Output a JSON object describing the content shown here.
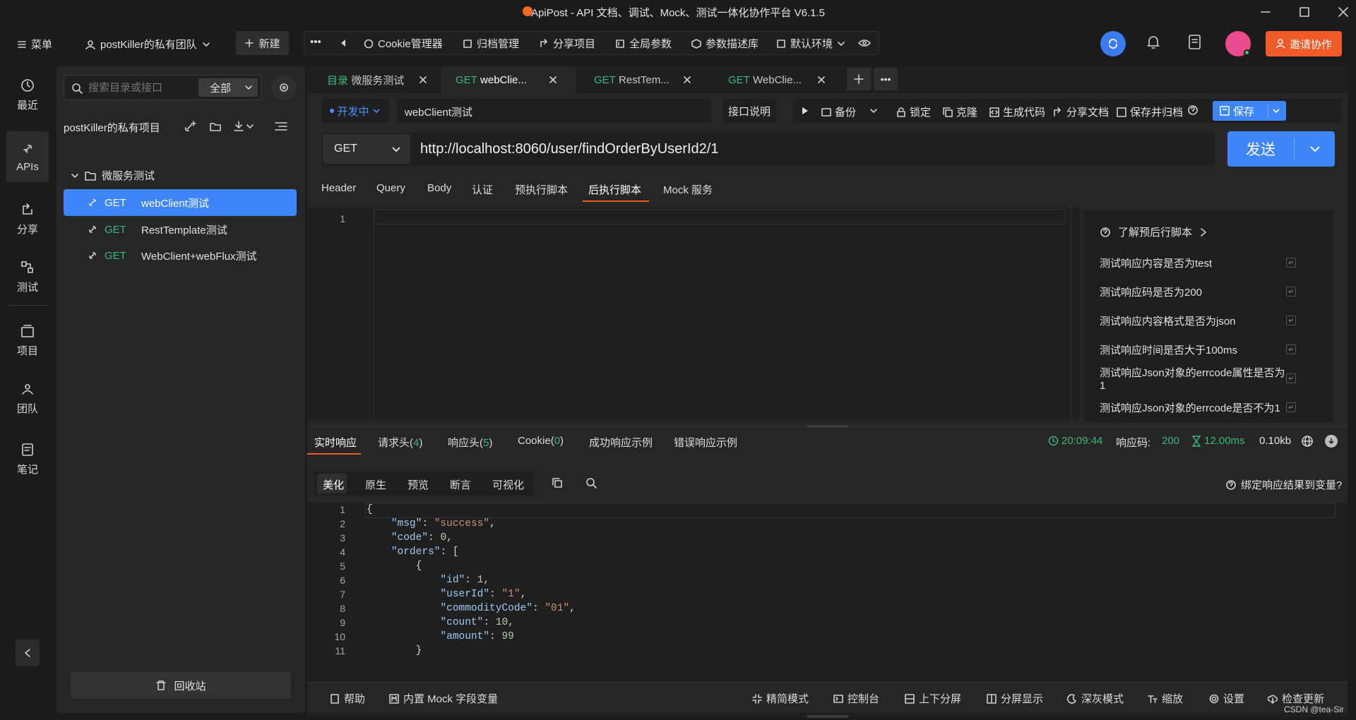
{
  "window": {
    "title": "ApiPost - API 文档、调试、Mock、测试一体化协作平台 V6.1.5"
  },
  "topbar": {
    "menu": "菜单",
    "team": "postKiller的私有团队",
    "new": "新建",
    "cookie": "Cookie管理器",
    "archive": "归档管理",
    "share": "分享项目",
    "global": "全局参数",
    "params": "参数描述库",
    "env": "默认环境",
    "invite": "邀请协作"
  },
  "nav": [
    {
      "label": "最近"
    },
    {
      "label": "APIs"
    },
    {
      "label": "分享"
    },
    {
      "label": "测试"
    },
    {
      "label": "项目"
    },
    {
      "label": "团队"
    },
    {
      "label": "笔记"
    }
  ],
  "sidebar": {
    "search_placeholder": "搜索目录或接口",
    "filter": "全部",
    "project": "postKiller的私有项目",
    "folder": "微服务测试",
    "items": [
      {
        "method": "GET",
        "name": "webClient测试"
      },
      {
        "method": "GET",
        "name": "RestTemplate测试"
      },
      {
        "method": "GET",
        "name": "WebClient+webFlux测试"
      }
    ],
    "recycle": "回收站"
  },
  "tabs": [
    {
      "prefix": "目录",
      "name": "微服务测试"
    },
    {
      "prefix": "GET",
      "name": "webClie..."
    },
    {
      "prefix": "GET",
      "name": "RestTem..."
    },
    {
      "prefix": "GET",
      "name": "WebClie..."
    }
  ],
  "request": {
    "status": "开发中",
    "name": "webClient测试",
    "doc": "接口说明",
    "backup": "备份",
    "lock": "锁定",
    "clone": "克隆",
    "gencode": "生成代码",
    "sharedoc": "分享文档",
    "savearchive": "保存并归档",
    "save": "保存",
    "method": "GET",
    "url": "http://localhost:8060/user/findOrderByUserId2/1",
    "send": "发送"
  },
  "req_tabs": [
    "Header",
    "Query",
    "Body",
    "认证",
    "预执行脚本",
    "后执行脚本",
    "Mock 服务"
  ],
  "editor_line": "1",
  "scripts": {
    "help": "了解预后行脚本",
    "items": [
      "测试响应内容是否为test",
      "测试响应码是否为200",
      "测试响应内容格式是否为json",
      "测试响应时间是否大于100ms",
      "测试响应Json对象的errcode属性是否为1",
      "测试响应Json对象的errcode是否不为1"
    ]
  },
  "resp_tabs": [
    {
      "label": "实时响应",
      "count": ""
    },
    {
      "label": "请求头",
      "count": "4"
    },
    {
      "label": "响应头",
      "count": "5"
    },
    {
      "label": "Cookie",
      "count": "0"
    },
    {
      "label": "成功响应示例",
      "count": ""
    },
    {
      "label": "错误响应示例",
      "count": ""
    }
  ],
  "resp_meta": {
    "time": "20:09:44",
    "code_label": "响应码:",
    "code": "200",
    "duration": "12.00ms",
    "size": "0.10kb"
  },
  "view_tabs": [
    "美化",
    "原生",
    "预览",
    "断言",
    "可视化"
  ],
  "bind_var": "绑定响应结果到变量?",
  "code_lines": [
    [
      {
        "t": "{",
        "c": ""
      }
    ],
    [
      {
        "t": "    ",
        "c": ""
      },
      {
        "t": "\"msg\"",
        "c": "k"
      },
      {
        "t": ": ",
        "c": ""
      },
      {
        "t": "\"success\"",
        "c": "s"
      },
      {
        "t": ",",
        "c": ""
      }
    ],
    [
      {
        "t": "    ",
        "c": ""
      },
      {
        "t": "\"code\"",
        "c": "k"
      },
      {
        "t": ": ",
        "c": ""
      },
      {
        "t": "0",
        "c": "n"
      },
      {
        "t": ",",
        "c": ""
      }
    ],
    [
      {
        "t": "    ",
        "c": ""
      },
      {
        "t": "\"orders\"",
        "c": "k"
      },
      {
        "t": ": [",
        "c": ""
      }
    ],
    [
      {
        "t": "        {",
        "c": ""
      }
    ],
    [
      {
        "t": "            ",
        "c": ""
      },
      {
        "t": "\"id\"",
        "c": "k"
      },
      {
        "t": ": ",
        "c": ""
      },
      {
        "t": "1",
        "c": "n"
      },
      {
        "t": ",",
        "c": ""
      }
    ],
    [
      {
        "t": "            ",
        "c": ""
      },
      {
        "t": "\"userId\"",
        "c": "k"
      },
      {
        "t": ": ",
        "c": ""
      },
      {
        "t": "\"1\"",
        "c": "s"
      },
      {
        "t": ",",
        "c": ""
      }
    ],
    [
      {
        "t": "            ",
        "c": ""
      },
      {
        "t": "\"commodityCode\"",
        "c": "k"
      },
      {
        "t": ": ",
        "c": ""
      },
      {
        "t": "\"01\"",
        "c": "s"
      },
      {
        "t": ",",
        "c": ""
      }
    ],
    [
      {
        "t": "            ",
        "c": ""
      },
      {
        "t": "\"count\"",
        "c": "k"
      },
      {
        "t": ": ",
        "c": ""
      },
      {
        "t": "10",
        "c": "n"
      },
      {
        "t": ",",
        "c": ""
      }
    ],
    [
      {
        "t": "            ",
        "c": ""
      },
      {
        "t": "\"amount\"",
        "c": "k"
      },
      {
        "t": ": ",
        "c": ""
      },
      {
        "t": "99",
        "c": "n"
      }
    ],
    [
      {
        "t": "        }",
        "c": ""
      }
    ]
  ],
  "bottombar": {
    "help": "帮助",
    "mock": "内置 Mock 字段变量",
    "simple": "精简模式",
    "console": "控制台",
    "updown": "上下分屏",
    "split": "分屏显示",
    "dark": "深灰模式",
    "zoom": "缩放",
    "settings": "设置",
    "update": "检查更新"
  },
  "watermark": "CSDN @tea-Sir"
}
